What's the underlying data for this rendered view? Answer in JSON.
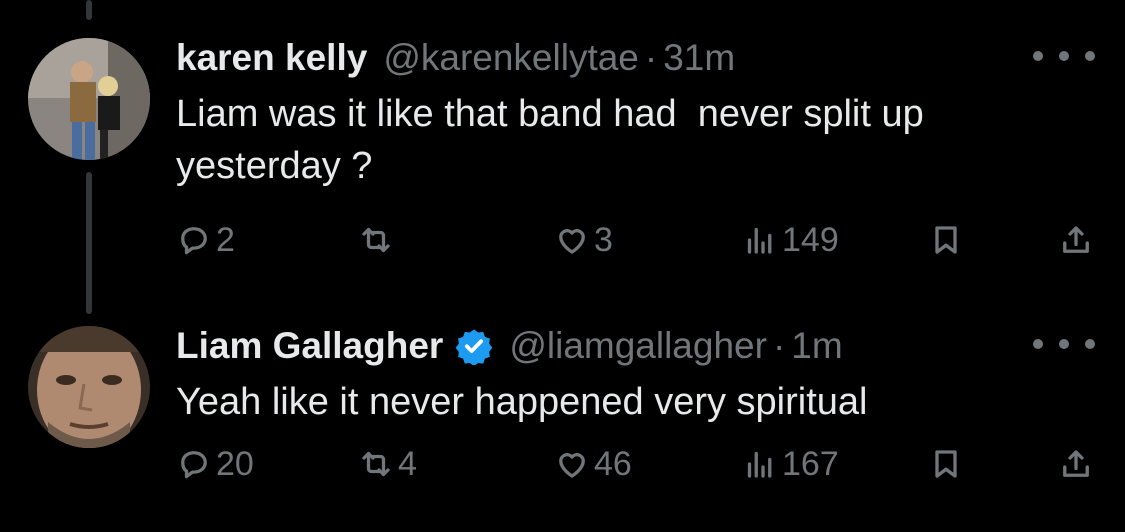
{
  "tweets": [
    {
      "name": "karen kelly",
      "handle": "@karenkellytae",
      "dot": "·",
      "time": "31m",
      "text": "Liam was it like that band had  never split up\nyesterday ?",
      "verified": false,
      "replies": "2",
      "retweets": "",
      "likes": "3",
      "views": "149"
    },
    {
      "name": "Liam Gallagher",
      "handle": "@liamgallagher",
      "dot": "·",
      "time": "1m",
      "text": "Yeah like it never happened very spiritual",
      "verified": true,
      "replies": "20",
      "retweets": "4",
      "likes": "46",
      "views": "167"
    }
  ],
  "colors": {
    "background": "#000000",
    "text": "#e7e9ea",
    "secondary": "#71767b",
    "verified": "#1d9bf0"
  },
  "icons": [
    "reply-icon",
    "retweet-icon",
    "like-icon",
    "views-icon",
    "bookmark-icon",
    "share-icon",
    "more-icon",
    "verified-badge-icon"
  ]
}
